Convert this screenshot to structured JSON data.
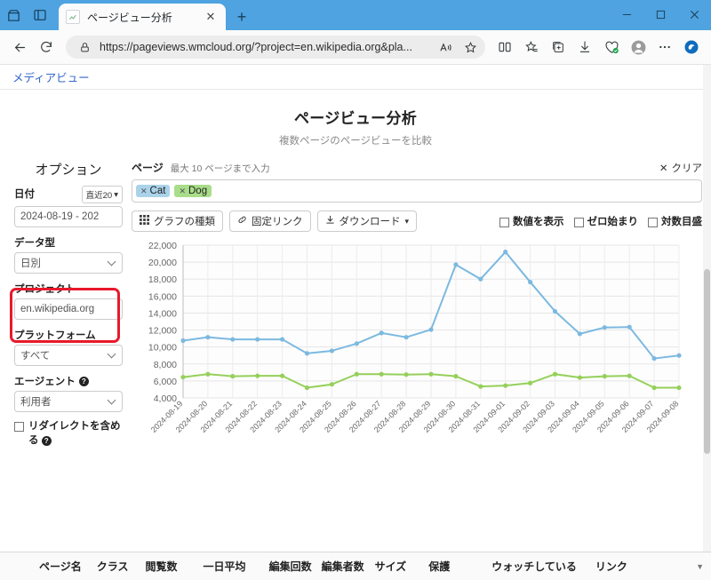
{
  "browser": {
    "tab": {
      "title": "ページビュー分析",
      "favicon_icon": "chart-favicon",
      "close_icon": "close-icon"
    },
    "new_tab_icon": "plus-icon",
    "copilot_icon": "copilot-icon",
    "tab_actions_icon": "tab-actions-icon",
    "split_panel_icon": "split-panel-icon",
    "window": {
      "minimize": "–",
      "maximize": "▢",
      "close": "✕"
    },
    "nav": {
      "back_icon": "back-arrow-icon",
      "reload_icon": "reload-icon"
    },
    "url": {
      "lock_icon": "lock-icon",
      "value": "https://pageviews.wmcloud.org/?project=en.wikipedia.org&pla...",
      "prefix": "https://",
      "host": "pageviews.wmcloud.org",
      "query": "/?project=en.wikipedia.org&pla...",
      "read_aloud_icon": "read-aloud-icon",
      "favorite_icon": "star-icon"
    },
    "actions": [
      {
        "name": "split-screen-icon",
        "glyph": "split"
      },
      {
        "name": "favorites-icon",
        "glyph": "star-list"
      },
      {
        "name": "collections-icon",
        "glyph": "collections"
      },
      {
        "name": "downloads-icon",
        "glyph": "download"
      },
      {
        "name": "browser-essentials-icon",
        "glyph": "heart-check"
      },
      {
        "name": "profile-avatar",
        "glyph": "person"
      },
      {
        "name": "settings-more-icon",
        "glyph": "ellipsis"
      },
      {
        "name": "copilot-icon",
        "glyph": "copilot"
      }
    ]
  },
  "page": {
    "topnav_link": "メディアビュー",
    "title": "ページビュー分析",
    "subtitle": "複数ページのページビューを比較"
  },
  "sidebar": {
    "heading": "オプション",
    "date": {
      "label": "日付",
      "preset_button": "直近20",
      "value": "2024-08-19 - 202"
    },
    "data_type": {
      "label": "データ型",
      "value": "日別"
    },
    "project": {
      "label": "プロジェクト",
      "value": "en.wikipedia.org",
      "highlighted": true
    },
    "platform": {
      "label": "プラットフォーム",
      "value": "すべて"
    },
    "agent": {
      "label": "エージェント",
      "value": "利用者",
      "has_help": true
    },
    "redirects": {
      "label": "リダイレクトを含める",
      "checked": false,
      "has_help": true
    }
  },
  "main": {
    "pages_label": "ページ",
    "pages_hint": "最大 10 ページまで入力",
    "clear_label": "クリア",
    "clear_icon": "close-x-icon",
    "tags": [
      {
        "label": "Cat",
        "color": "#aad3ea",
        "remove_icon": "x-icon"
      },
      {
        "label": "Dog",
        "color": "#a9dd8a",
        "remove_icon": "x-icon"
      }
    ],
    "buttons": [
      {
        "label": "グラフの種類",
        "icon": "grid-icon",
        "caret": false
      },
      {
        "label": "固定リンク",
        "icon": "link-icon",
        "caret": false
      },
      {
        "label": "ダウンロード",
        "icon": "download-icon",
        "caret": true
      }
    ],
    "checkboxes": [
      {
        "label": "数値を表示",
        "checked": false
      },
      {
        "label": "ゼロ始まり",
        "checked": false
      },
      {
        "label": "対数目盛",
        "checked": false
      }
    ]
  },
  "table": {
    "headers": [
      "ページ名",
      "クラス",
      "閲覧数",
      "一日平均",
      "編集回数",
      "編集者数",
      "サイズ",
      "保護",
      "ウォッチしている",
      "リンク"
    ],
    "scroll_caret_icon": "caret-down-icon"
  },
  "chart_data": {
    "type": "line",
    "title": "",
    "xlabel": "",
    "ylabel": "",
    "ylim": [
      4000,
      22000
    ],
    "ytick_step": 2000,
    "yticks": [
      "4,000",
      "6,000",
      "8,000",
      "10,000",
      "12,000",
      "14,000",
      "16,000",
      "18,000",
      "20,000",
      "22,000"
    ],
    "grid": true,
    "legend": "none",
    "x": [
      "2024-08-19",
      "2024-08-20",
      "2024-08-21",
      "2024-08-22",
      "2024-08-23",
      "2024-08-24",
      "2024-08-25",
      "2024-08-26",
      "2024-08-27",
      "2024-08-28",
      "2024-08-29",
      "2024-08-30",
      "2024-08-31",
      "2024-09-01",
      "2024-09-02",
      "2024-09-03",
      "2024-09-04",
      "2024-09-05",
      "2024-09-06",
      "2024-09-07",
      "2024-09-08"
    ],
    "series": [
      {
        "name": "Cat",
        "color": "#7cb9e0",
        "values": [
          10750,
          11150,
          10900,
          10900,
          10900,
          9250,
          9550,
          10400,
          11650,
          11150,
          12050,
          19700,
          18000,
          21200,
          17650,
          14200,
          11550,
          12300,
          12350,
          8650,
          9000
        ]
      },
      {
        "name": "Dog",
        "color": "#95d05a",
        "values": [
          6450,
          6800,
          6550,
          6600,
          6600,
          5200,
          5600,
          6800,
          6800,
          6750,
          6800,
          6550,
          5350,
          5450,
          5750,
          6800,
          6400,
          6550,
          6600,
          5200,
          5200
        ]
      }
    ]
  }
}
